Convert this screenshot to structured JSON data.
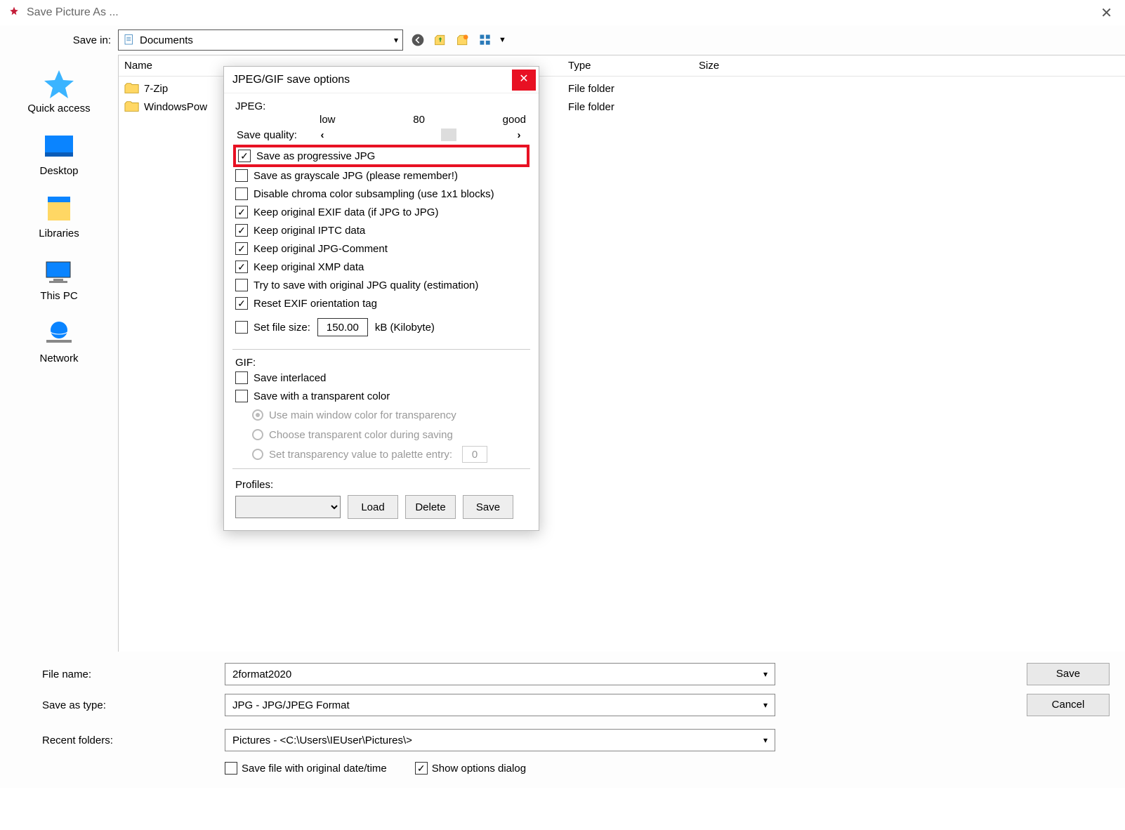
{
  "window": {
    "title": "Save Picture As ..."
  },
  "savein": {
    "label": "Save in:",
    "value": "Documents"
  },
  "places": {
    "quick_access": "Quick access",
    "desktop": "Desktop",
    "libraries": "Libraries",
    "this_pc": "This PC",
    "network": "Network"
  },
  "columns": {
    "name": "Name",
    "type": "Type",
    "size": "Size"
  },
  "rows": [
    {
      "name": "7-Zip",
      "type": "File folder"
    },
    {
      "name": "WindowsPow",
      "type": "File folder"
    }
  ],
  "bottom": {
    "filename_label": "File name:",
    "filename_value": "2format2020",
    "savetype_label": "Save as type:",
    "savetype_value": "JPG - JPG/JPEG Format",
    "recent_label": "Recent folders:",
    "recent_value": "Pictures  -  <C:\\Users\\IEUser\\Pictures\\>",
    "save_btn": "Save",
    "cancel_btn": "Cancel",
    "chk_save_date": "Save file with original date/time",
    "chk_show_options": "Show options dialog"
  },
  "popup": {
    "title": "JPEG/GIF save options",
    "jpeg_label": "JPEG:",
    "quality_low": "low",
    "quality_val": "80",
    "quality_good": "good",
    "quality_label": "Save quality:",
    "opts": {
      "progressive": "Save as progressive JPG",
      "grayscale": "Save as grayscale JPG (please remember!)",
      "chroma": "Disable chroma color subsampling (use 1x1 blocks)",
      "exif": "Keep original EXIF data (if JPG to JPG)",
      "iptc": "Keep original IPTC data",
      "comment": "Keep original JPG-Comment",
      "xmp": "Keep original XMP data",
      "origq": "Try to save with original JPG quality (estimation)",
      "resetexif": "Reset EXIF orientation tag",
      "filesize_label": "Set file size:",
      "filesize_val": "150.00",
      "filesize_unit": "kB (Kilobyte)"
    },
    "gif_label": "GIF:",
    "gif": {
      "interlaced": "Save interlaced",
      "transparent": "Save with a transparent color",
      "r1": "Use main window color for transparency",
      "r2": "Choose transparent color during saving",
      "r3": "Set transparency value to palette entry:",
      "r3_val": "0"
    },
    "profiles_label": "Profiles:",
    "load_btn": "Load",
    "delete_btn": "Delete",
    "save_btn": "Save"
  }
}
